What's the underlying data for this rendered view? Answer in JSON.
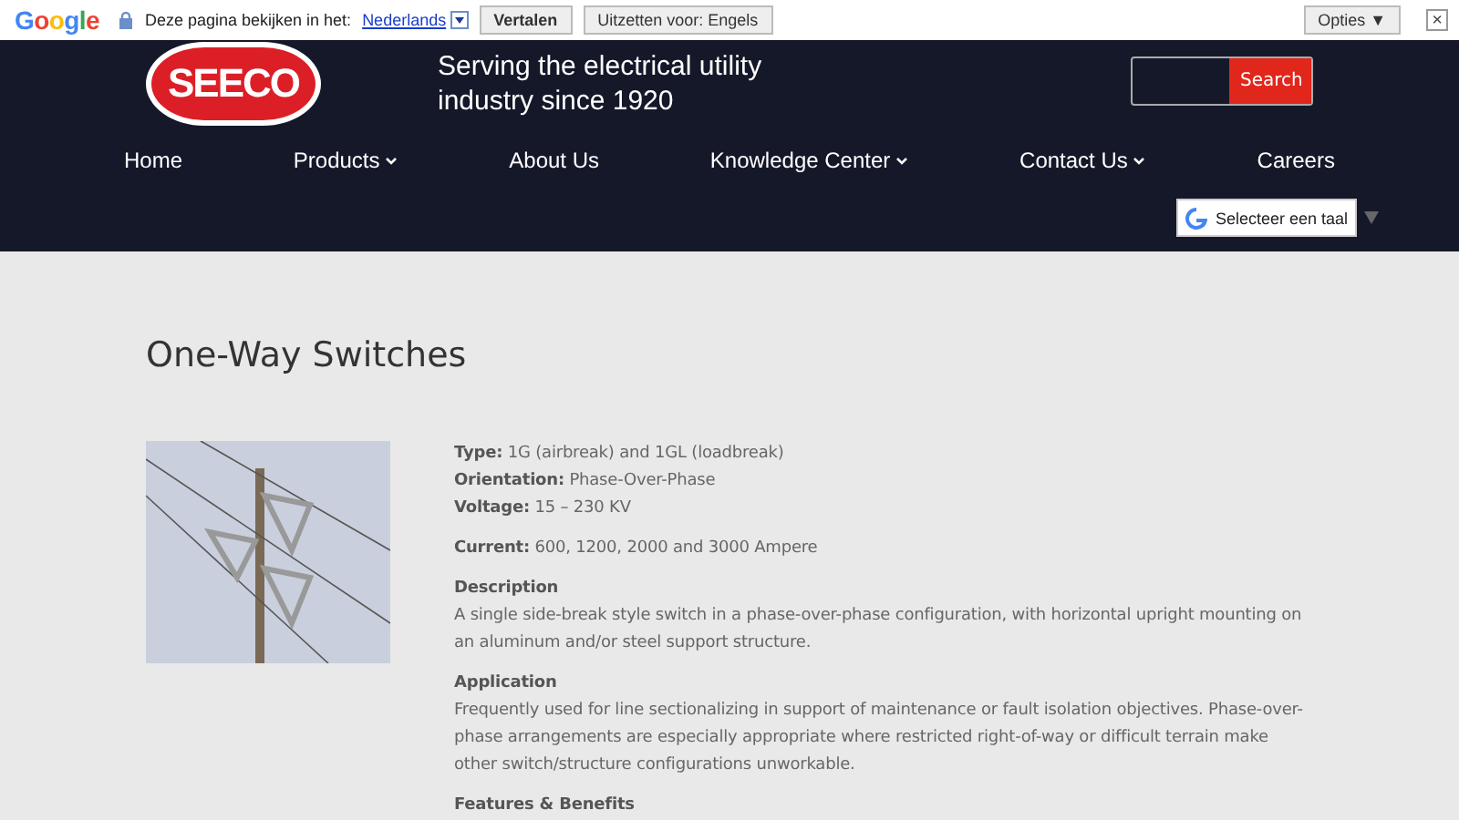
{
  "translate_bar": {
    "brand": "Google",
    "prompt": "Deze pagina bekijken in het:",
    "language": "Nederlands",
    "translate_button": "Vertalen",
    "off_button": "Uitzetten voor: Engels",
    "options_button": "Opties ▼",
    "close": "×"
  },
  "header": {
    "logo": "SEECO",
    "tagline": [
      "Serving the electrical utility",
      "industry since 1920"
    ],
    "search_button": "Search",
    "nav": [
      {
        "label": "Home",
        "dropdown": false
      },
      {
        "label": "Products",
        "dropdown": true
      },
      {
        "label": "About Us",
        "dropdown": false
      },
      {
        "label": "Knowledge Center",
        "dropdown": true
      },
      {
        "label": "Contact Us",
        "dropdown": true
      },
      {
        "label": "Careers",
        "dropdown": false
      }
    ],
    "language_select": "Selecteer een taal"
  },
  "page": {
    "title": "One-Way Switches",
    "specs": [
      {
        "kind": "line",
        "text": "**Type:** 1G (airbreak) and 1GL (loadbreak)"
      },
      {
        "kind": "line",
        "text": "**Orientation:** Phase-Over-Phase"
      },
      {
        "kind": "line",
        "text": "**Voltage:** 15 – 230 KV"
      },
      {
        "kind": "gap"
      },
      {
        "kind": "line",
        "text": "**Current:** 600, 1200, 2000 and 3000 Ampere"
      },
      {
        "kind": "gap"
      },
      {
        "kind": "heading",
        "text": "Description"
      },
      {
        "kind": "para",
        "text": "A single side-break style switch in a phase-over-phase configuration, with horizontal upright mounting on an aluminum and/or steel support structure."
      },
      {
        "kind": "gap"
      },
      {
        "kind": "heading",
        "text": "Application"
      },
      {
        "kind": "para",
        "text": "Frequently used for line sectionalizing in support of maintenance or fault isolation objectives. Phase-over-phase arrangements are especially appropriate where restricted right-of-way or difficult terrain make other switch/structure configurations unworkable."
      },
      {
        "kind": "gap"
      },
      {
        "kind": "heading",
        "text": "Features & Benefits"
      }
    ]
  }
}
